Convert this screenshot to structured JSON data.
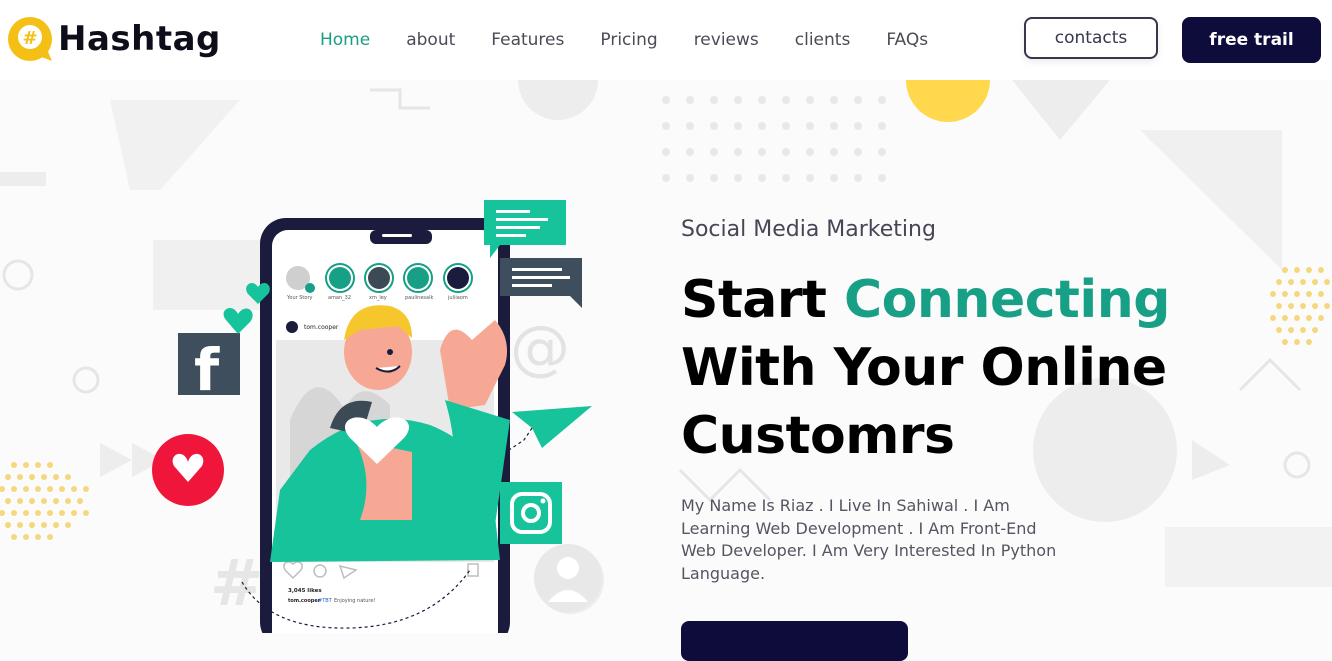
{
  "brand": {
    "name": "Hashtag",
    "logo_icon": "hashtag-bubble-icon",
    "accent": "#f5c016"
  },
  "nav": {
    "items": [
      {
        "label": "Home",
        "active": true
      },
      {
        "label": "about",
        "active": false
      },
      {
        "label": "Features",
        "active": false
      },
      {
        "label": "Pricing",
        "active": false
      },
      {
        "label": "reviews",
        "active": false
      },
      {
        "label": "clients",
        "active": false
      },
      {
        "label": "FAQs",
        "active": false
      }
    ]
  },
  "header_buttons": {
    "contacts": "contacts",
    "free_trail": "free trail"
  },
  "hero": {
    "eyebrow": "Social Media Marketing",
    "headline_1": "Start ",
    "headline_accent": "Connecting",
    "headline_2": "With Your Online",
    "headline_3": "Customrs",
    "description": "My Name Is Riaz . I Live In Sahiwal . I Am Learning Web Development . I Am Front-End Web Developer. I Am Very Interested In Python Language."
  },
  "phone": {
    "stories": [
      "Your Story",
      "aman_32",
      "xm_ley",
      "paulinesalk",
      "juliiaom"
    ],
    "post_user": "tom.cooper",
    "likes": "3,045 likes",
    "caption_user": "tom.cooper",
    "caption_tag": "#TBT",
    "caption_text": "Enjoying nature!"
  },
  "colors": {
    "primary": "#17a085",
    "dark": "#0d0c3a",
    "heart": "#f0163b",
    "facebook": "#3f4e5c"
  }
}
